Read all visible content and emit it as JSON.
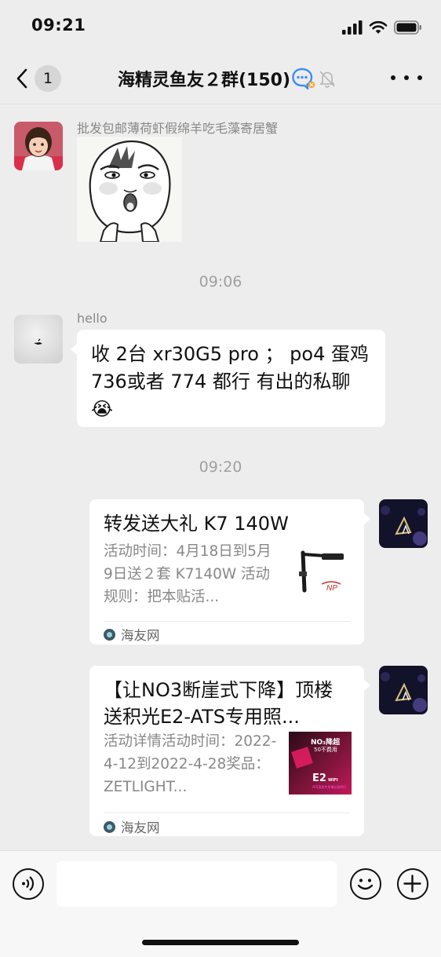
{
  "status_bar": {
    "time": "09:21"
  },
  "header": {
    "unread_count": "1",
    "title": "海精灵鱼友２群(150)"
  },
  "messages": [
    {
      "sender": "批发包邮薄荷虾假绵羊吃毛藻寄居蟹",
      "type": "sticker"
    },
    {
      "timestamp": "09:06"
    },
    {
      "sender": "hello",
      "text": "收 2台 xr30G5 pro ； po4 蛋鸡 736或者 774 都行 有出的私聊",
      "emoji": "😭"
    },
    {
      "timestamp": "09:20"
    },
    {
      "type": "link-card",
      "title": "转发送大礼 K7 140W",
      "description": "活动时间：4月18日到5月9日送２套 K7140W 活动规则：把本贴活...",
      "source": "海友网"
    },
    {
      "type": "link-card",
      "title": "【让NO3断崖式下降】顶楼送积光E2-ATS专用照...",
      "description": "活动详情活动时间：2022-4-12到2022-4-28奖品：ZETLIGHT...",
      "source": "海友网",
      "thumb_text": {
        "top": "NO₃降超",
        "sub": "50不费用",
        "brand": "E2",
        "wifi": "WIFI",
        "small": "ATS藻类专用增长照明灯"
      }
    }
  ],
  "colors": {
    "background": "#ededed",
    "bubble": "#ffffff",
    "secondary_text": "#888888"
  }
}
